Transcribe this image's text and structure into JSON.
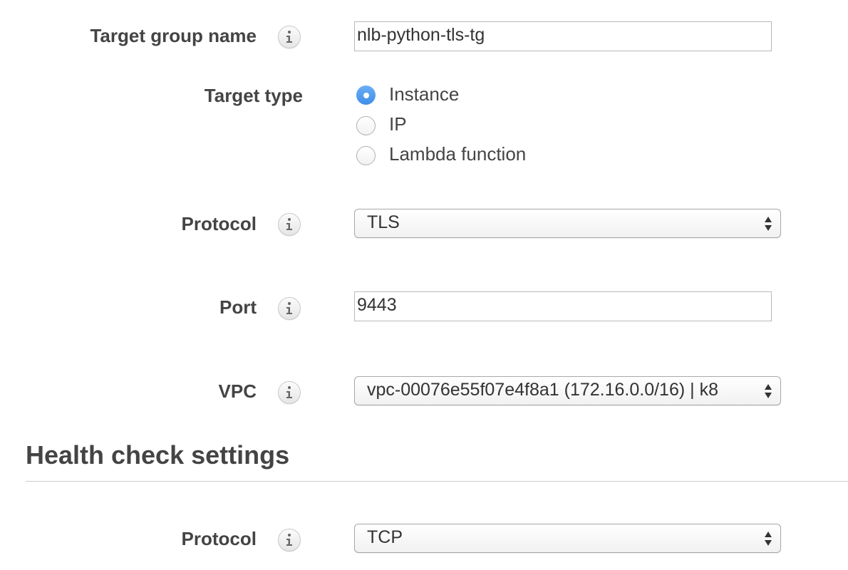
{
  "target_group": {
    "name_label": "Target group name",
    "name_value": "nlb-python-tls-tg",
    "type_label": "Target type",
    "type_options": [
      "Instance",
      "IP",
      "Lambda function"
    ],
    "type_selected": "Instance",
    "protocol_label": "Protocol",
    "protocol_value": "TLS",
    "port_label": "Port",
    "port_value": "9443",
    "vpc_label": "VPC",
    "vpc_value": "vpc-00076e55f07e4f8a1 (172.16.0.0/16) | k8"
  },
  "health_check": {
    "title": "Health check settings",
    "protocol_label": "Protocol",
    "protocol_value": "TCP"
  },
  "icons": {
    "info": "info-icon",
    "select_arrows": "select-arrows-icon"
  },
  "colors": {
    "label": "#444444",
    "radio_selected": "#4a97ee",
    "divider": "#cccccc"
  }
}
